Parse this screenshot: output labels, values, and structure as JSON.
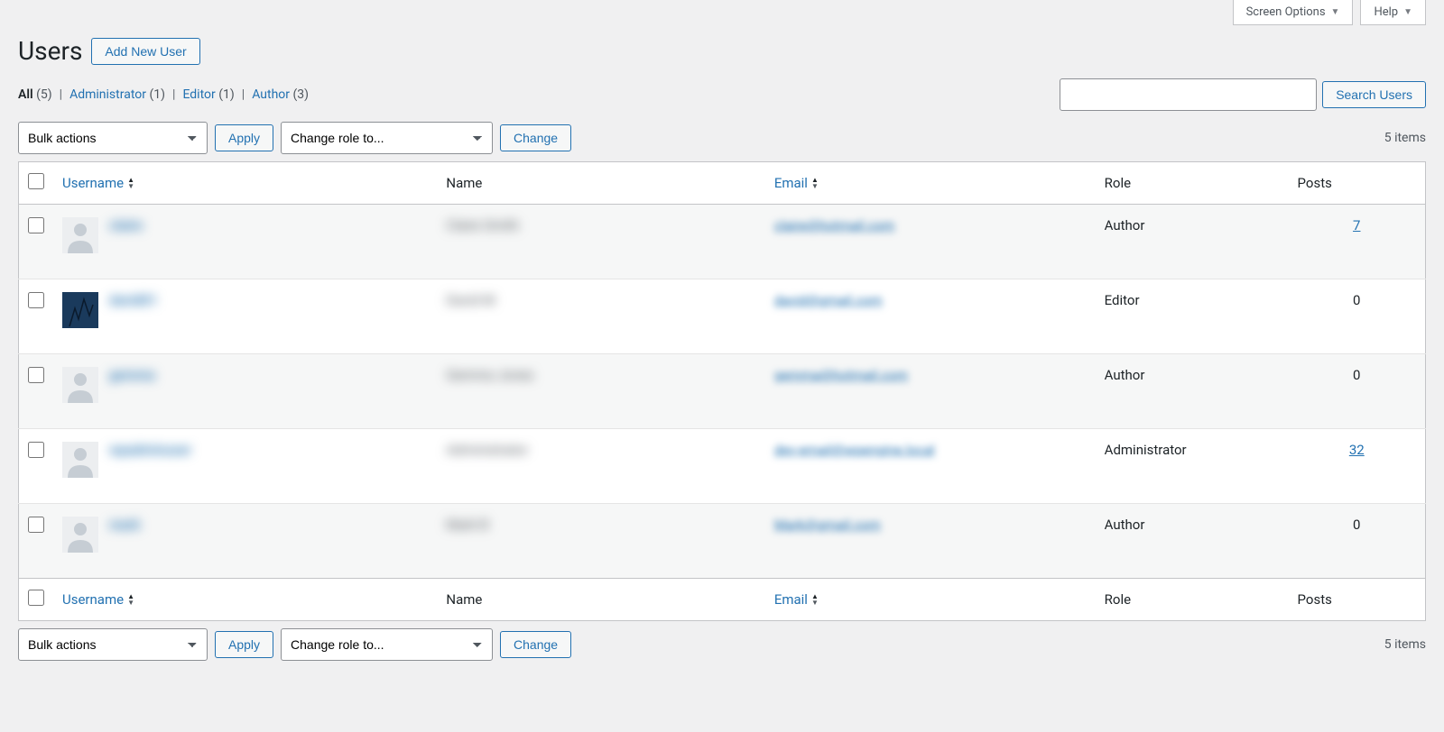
{
  "top": {
    "screen_options": "Screen Options",
    "help": "Help"
  },
  "heading": "Users",
  "add_new": "Add New User",
  "filters": {
    "all_label": "All",
    "all_count": "(5)",
    "admin_label": "Administrator",
    "admin_count": "(1)",
    "editor_label": "Editor",
    "editor_count": "(1)",
    "author_label": "Author",
    "author_count": "(3)"
  },
  "search_button": "Search Users",
  "bulk_actions": "Bulk actions",
  "apply": "Apply",
  "change_role": "Change role to...",
  "change": "Change",
  "items_count": "5 items",
  "columns": {
    "username": "Username",
    "name": "Name",
    "email": "Email",
    "role": "Role",
    "posts": "Posts"
  },
  "rows": [
    {
      "username": "claire",
      "name": "Claire Smith",
      "email": "claire@hotmail.com",
      "role": "Author",
      "posts": "7",
      "avatar": "default"
    },
    {
      "username": "david01",
      "name": "David M",
      "email": "david@gmail.com",
      "role": "Editor",
      "posts": "0",
      "avatar": "tree"
    },
    {
      "username": "gemma",
      "name": "Gemma Jones",
      "email": "gemma@hotmail.com",
      "role": "Author",
      "posts": "0",
      "avatar": "default"
    },
    {
      "username": "wpadminuser",
      "name": "Administrator",
      "email": "dev-email@wpengine.local",
      "role": "Administrator",
      "posts": "32",
      "avatar": "default"
    },
    {
      "username": "mark",
      "name": "Mark B",
      "email": "Mark@gmail.com",
      "role": "Author",
      "posts": "0",
      "avatar": "default"
    }
  ]
}
